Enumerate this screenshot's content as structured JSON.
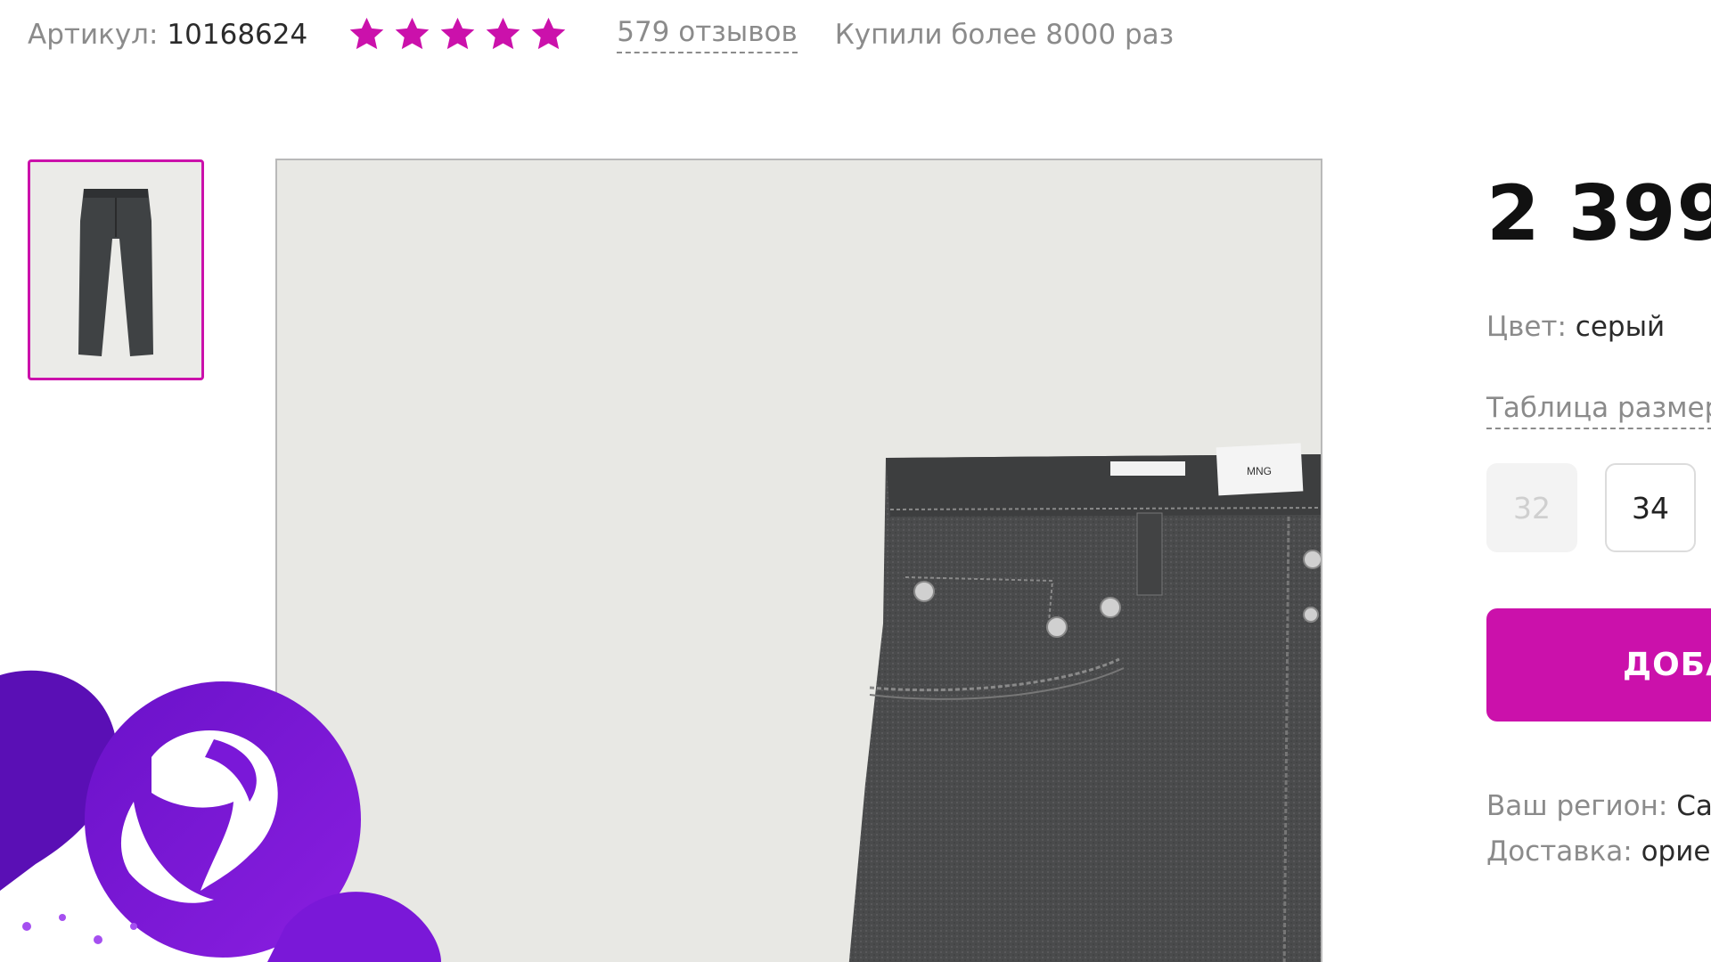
{
  "product": {
    "sku_label": "Артикул:",
    "sku_value": "10168624",
    "rating_stars": 5,
    "reviews_label": "579 отзывов",
    "bought_label": "Купили более 8000 раз",
    "star_color": "#cb11ab"
  },
  "gallery": {
    "thumbnail_selected": true,
    "accent_color": "#cb11ab"
  },
  "details": {
    "price": "2 399",
    "color_label": "Цвет:",
    "color_value": "серый",
    "size_table_label": "Таблица размер",
    "sizes": [
      {
        "label": "32",
        "available": false
      },
      {
        "label": "34",
        "available": true
      }
    ],
    "add_button_label": "ДОБА",
    "region_label": "Ваш регион:",
    "region_value": "Са",
    "delivery_label": "Доставка:",
    "delivery_value": "орие"
  },
  "brand": {
    "logo_color": "#7b12d6"
  }
}
